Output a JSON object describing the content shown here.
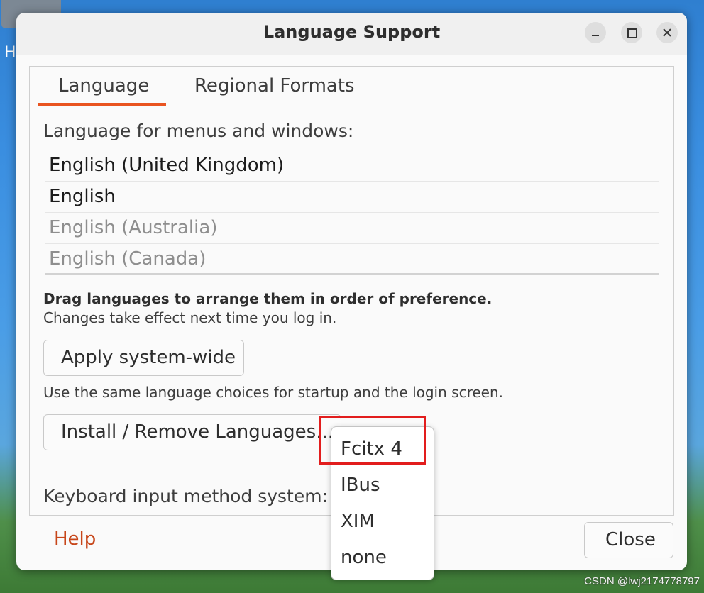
{
  "window": {
    "title": "Language Support"
  },
  "tabs": [
    "Language",
    "Regional Formats"
  ],
  "language_panel": {
    "heading": "Language for menus and windows:",
    "languages": [
      "English (United Kingdom)",
      "English",
      "English (Australia)",
      "English (Canada)"
    ],
    "drag_hint": "Drag languages to arrange them in order of preference.",
    "effect_note": "Changes take effect next time you log in.",
    "apply_button": "Apply system-wide",
    "apply_note": "Use the same language choices for startup and the login screen.",
    "install_button": "Install / Remove Languages...",
    "input_method_label": "Keyboard input method system:"
  },
  "input_method_options": [
    "Fcitx 4",
    "IBus",
    "XIM",
    "none"
  ],
  "footer": {
    "help": "Help",
    "close": "Close"
  },
  "desktop": {
    "icon_label_partial": "H",
    "watermark": "CSDN @lwj2174778797"
  },
  "colors": {
    "accent": "#e95420",
    "highlight_box": "#e21d1d",
    "help_link": "#c7461a"
  }
}
